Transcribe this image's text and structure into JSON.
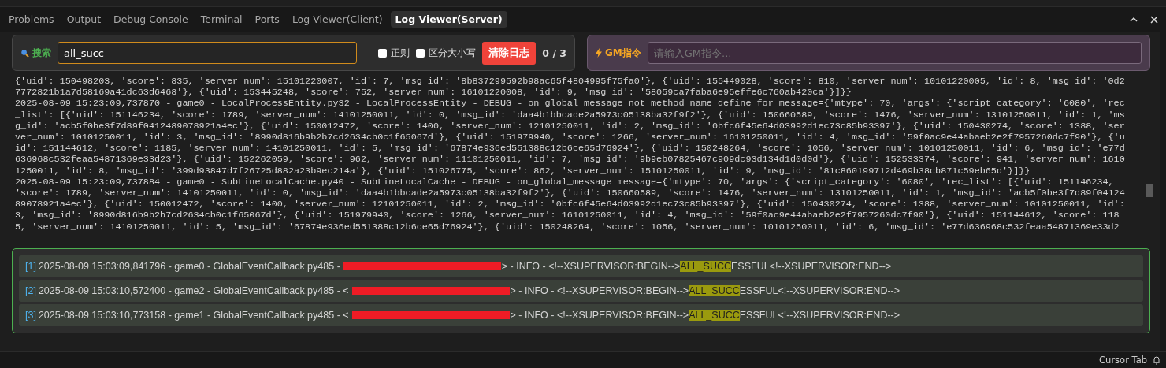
{
  "tabs": [
    {
      "label": "Problems",
      "selected": false
    },
    {
      "label": "Output",
      "selected": false
    },
    {
      "label": "Debug Console",
      "selected": false
    },
    {
      "label": "Terminal",
      "selected": false
    },
    {
      "label": "Ports",
      "selected": false
    },
    {
      "label": "Log Viewer(Client)",
      "selected": false
    },
    {
      "label": "Log Viewer(Server)",
      "selected": true
    }
  ],
  "search": {
    "label": "搜索",
    "value": "all_succ",
    "options": [
      {
        "label": "正则",
        "checked": false
      },
      {
        "label": "区分大小写",
        "checked": false
      }
    ],
    "clear_button": "清除日志",
    "count": "0 / 3"
  },
  "gm": {
    "label": "GM指令",
    "placeholder": "请输入GM指令..."
  },
  "log_lines": [
    "{'uid': 150498203, 'score': 835, 'server_num': 15101220007, 'id': 7, 'msg_id': '8b837299592b98ac65f4804995f75fa0'}, {'uid': 155449028, 'score': 810, 'server_num': 10101220005, 'id': 8, 'msg_id': '0d2",
    "7772821b1a7d58169a41dc63d6468'}, {'uid': 153445248, 'score': 752, 'server_num': 16101220008, 'id': 9, 'msg_id': '58059ca7faba6e95effe6c760ab420ca'}]}}",
    "2025-08-09 15:23:09,737870 - game0 - LocalProcessEntity.py32 - LocalProcessEntity - DEBUG - on_global_message not method_name define for message={'mtype': 70, 'args': {'script_category': '6080', 'rec",
    "_list': [{'uid': 151146234, 'score': 1789, 'server_num': 14101250011, 'id': 0, 'msg_id': 'daa4b1bbcade2a5973c05138ba32f9f2'}, {'uid': 150660589, 'score': 1476, 'server_num': 13101250011, 'id': 1, 'ms",
    "g_id': 'acb5f0be3f7d89f0412489078921a4ec'}, {'uid': 150012472, 'score': 1400, 'server_num': 12101250011, 'id': 2, 'msg_id': '0bfc6f45e64d03992d1ec73c85b93397'}, {'uid': 150430274, 'score': 1388, 'ser",
    "ver_num': 10101250011, 'id': 3, 'msg_id': '8990d816b9b2b7cd2634cb0c1f65067d'}, {'uid': 151979940, 'score': 1266, 'server_num': 16101250011, 'id': 4, 'msg_id': '59f0ac9e44abaeb2e2f7957260dc7f90'}, {'u",
    "id': 151144612, 'score': 1185, 'server_num': 14101250011, 'id': 5, 'msg_id': '67874e936ed551388c12b6ce65d76924'}, {'uid': 150248264, 'score': 1056, 'server_num': 10101250011, 'id': 6, 'msg_id': 'e77d",
    "636968c532feaa54871369e33d23'}, {'uid': 152262059, 'score': 962, 'server_num': 11101250011, 'id': 7, 'msg_id': '9b9eb07825467c909dc93d134d1d0d0d'}, {'uid': 152533374, 'score': 941, 'server_num': 1610",
    "1250011, 'id': 8, 'msg_id': '399d93847d7f26725d882a23b9ec214a'}, {'uid': 151026775, 'score': 862, 'server_num': 15101250011, 'id': 9, 'msg_id': '81c860199712d469b38cb871c59eb65d'}]}}",
    "2025-08-09 15:23:09,737884 - game0 - SubLineLocalCache.py40 - SubLineLocalCache - DEBUG - on_global_message message={'mtype': 70, 'args': {'script_category': '6080', 'rec_list': [{'uid': 151146234,",
    "'score': 1789, 'server_num': 14101250011, 'id': 0, 'msg_id': 'daa4b1bbcade2a5973c05138ba32f9f2'}, {'uid': 150660589, 'score': 1476, 'server_num': 13101250011, 'id': 1, 'msg_id': 'acb5f0be3f7d89f04124",
    "89078921a4ec'}, {'uid': 150012472, 'score': 1400, 'server_num': 12101250011, 'id': 2, 'msg_id': '0bfc6f45e64d03992d1ec73c85b93397'}, {'uid': 150430274, 'score': 1388, 'server_num': 10101250011, 'id':",
    "3, 'msg_id': '8990d816b9b2b7cd2634cb0c1f65067d'}, {'uid': 151979940, 'score': 1266, 'server_num': 16101250011, 'id': 4, 'msg_id': '59f0ac9e44abaeb2e2f7957260dc7f90'}, {'uid': 151144612, 'score': 118",
    "5, 'server_num': 14101250011, 'id': 5, 'msg_id': '67874e936ed551388c12b6ce65d76924'}, {'uid': 150248264, 'score': 1056, 'server_num': 10101250011, 'id': 6, 'msg_id': 'e77d636968c532feaa54871369e33d2"
  ],
  "results": [
    {
      "index": "[1]",
      "before": "2025-08-09 15:03:09,841796 - game0 - GlobalEventCallback.py485 -",
      "after": "> - INFO - <!--XSUPERVISOR:BEGIN-->",
      "match": "ALL_SUCC",
      "rest": "ESSFUL<!--XSUPERVISOR:END-->"
    },
    {
      "index": "[2]",
      "before": "2025-08-09 15:03:10,572400 - game2 - GlobalEventCallback.py485 - <",
      "after": "> - INFO - <!--XSUPERVISOR:BEGIN-->",
      "match": "ALL_SUCC",
      "rest": "ESSFUL<!--XSUPERVISOR:END-->"
    },
    {
      "index": "[3]",
      "before": "2025-08-09 15:03:10,773158 - game1 - GlobalEventCallback.py485 - <",
      "after": "> - INFO - <!--XSUPERVISOR:BEGIN-->",
      "match": "ALL_SUCC",
      "rest": "ESSFUL<!--XSUPERVISOR:END-->"
    }
  ],
  "status_bar": {
    "label": "Cursor Tab"
  }
}
